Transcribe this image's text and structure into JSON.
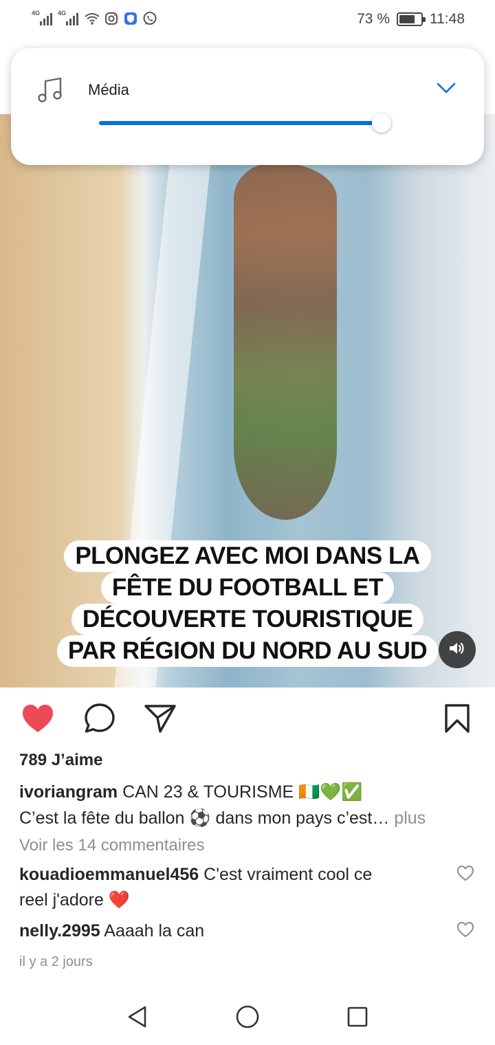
{
  "status_bar": {
    "signal1_label": "4G",
    "signal2_label": "4G",
    "battery_text": "73 %",
    "battery_level": 0.73,
    "time": "11:48",
    "icons": [
      "signal-icon",
      "signal-icon",
      "wifi-icon",
      "instagram-icon",
      "shield-icon",
      "whatsapp-icon",
      "battery-icon"
    ]
  },
  "volume_panel": {
    "label": "Média",
    "level": 0.97,
    "accent_color": "#0a6ede"
  },
  "video": {
    "caption_lines": [
      "PLONGEZ AVEC MOI DANS  LA",
      "FÊTE DU FOOTBALL ET",
      "DÉCOUVERTE TOURISTIQUE",
      "PAR RÉGION DU NORD AU SUD"
    ],
    "mute_icon": "speaker-icon"
  },
  "actions": {
    "like_color": "#ed4956",
    "liked": true
  },
  "post": {
    "likes": "789 J’aime",
    "username": "ivoriangram",
    "caption_line1": "CAN 23 & TOURISME 🇨🇮💚✅",
    "caption_line2": "C’est la fête du ballon ⚽ dans mon pays c’est…",
    "more": "plus",
    "view_comments": "Voir les 14 commentaires",
    "comments": [
      {
        "user": "kouadioemmanuel456",
        "text": "C'est vraiment cool ce",
        "text2": "reel j'adore ❤️"
      },
      {
        "user": "nelly.2995",
        "text": "Aaaah la can"
      }
    ],
    "timestamp": "il y a 2 jours"
  }
}
